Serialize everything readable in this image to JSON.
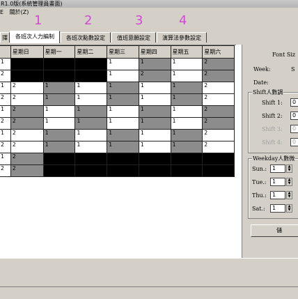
{
  "window": {
    "title": "R1.0版(系統管理員畫面)"
  },
  "menu": [
    {
      "label": "E"
    },
    {
      "label": "關於(Z)"
    }
  ],
  "annotations": [
    "1",
    "2",
    "3",
    "4"
  ],
  "tabs": [
    {
      "label": "擇"
    },
    {
      "label": "各班次人力編制"
    },
    {
      "label": "各班次點數設定"
    },
    {
      "label": "值班意願設定"
    },
    {
      "label": "演算法參數設定"
    }
  ],
  "table": {
    "headers": [
      "",
      "星期日",
      "星期一",
      "星期二",
      "星期三",
      "星期四",
      "星期五",
      "星期六"
    ],
    "rows": [
      {
        "label": "1",
        "cells": [
          {
            "c": "b",
            "v": ""
          },
          {
            "c": "b",
            "v": ""
          },
          {
            "c": "b",
            "v": ""
          },
          {
            "c": "w",
            "v": "1"
          },
          {
            "c": "g",
            "v": "1"
          },
          {
            "c": "w",
            "v": "1"
          },
          {
            "c": "g",
            "v": "2"
          }
        ]
      },
      {
        "label": "2",
        "cells": [
          {
            "c": "b",
            "v": ""
          },
          {
            "c": "b",
            "v": ""
          },
          {
            "c": "b",
            "v": ""
          },
          {
            "c": "w",
            "v": "1"
          },
          {
            "c": "g",
            "v": "2"
          },
          {
            "c": "w",
            "v": "1"
          },
          {
            "c": "g",
            "v": "2"
          }
        ]
      },
      {
        "label": "1",
        "cells": [
          {
            "c": "w",
            "v": "2"
          },
          {
            "c": "g",
            "v": "1"
          },
          {
            "c": "w",
            "v": "1"
          },
          {
            "c": "g",
            "v": "1"
          },
          {
            "c": "w",
            "v": "1"
          },
          {
            "c": "g",
            "v": "1"
          },
          {
            "c": "w",
            "v": "2"
          }
        ]
      },
      {
        "label": "2",
        "cells": [
          {
            "c": "w",
            "v": "2"
          },
          {
            "c": "g",
            "v": "1"
          },
          {
            "c": "w",
            "v": "1"
          },
          {
            "c": "g",
            "v": "1"
          },
          {
            "c": "w",
            "v": "1"
          },
          {
            "c": "g",
            "v": "1"
          },
          {
            "c": "w",
            "v": "2"
          }
        ]
      },
      {
        "label": "1",
        "cells": [
          {
            "c": "g",
            "v": "2"
          },
          {
            "c": "w",
            "v": "1"
          },
          {
            "c": "g",
            "v": "1"
          },
          {
            "c": "w",
            "v": "1"
          },
          {
            "c": "g",
            "v": "1"
          },
          {
            "c": "w",
            "v": "1"
          },
          {
            "c": "g",
            "v": "2"
          }
        ]
      },
      {
        "label": "2",
        "cells": [
          {
            "c": "g",
            "v": "2"
          },
          {
            "c": "w",
            "v": "1"
          },
          {
            "c": "g",
            "v": "1"
          },
          {
            "c": "w",
            "v": "1"
          },
          {
            "c": "g",
            "v": "1"
          },
          {
            "c": "w",
            "v": "1"
          },
          {
            "c": "g",
            "v": "2"
          }
        ]
      },
      {
        "label": "1",
        "cells": [
          {
            "c": "w",
            "v": "2"
          },
          {
            "c": "g",
            "v": "1"
          },
          {
            "c": "w",
            "v": "1"
          },
          {
            "c": "g",
            "v": "1"
          },
          {
            "c": "w",
            "v": "1"
          },
          {
            "c": "g",
            "v": "1"
          },
          {
            "c": "w",
            "v": "2"
          }
        ]
      },
      {
        "label": "2",
        "cells": [
          {
            "c": "w",
            "v": "2"
          },
          {
            "c": "g",
            "v": "1"
          },
          {
            "c": "w",
            "v": "1"
          },
          {
            "c": "g",
            "v": "1"
          },
          {
            "c": "w",
            "v": "1"
          },
          {
            "c": "g",
            "v": "1"
          },
          {
            "c": "w",
            "v": "2"
          }
        ]
      },
      {
        "label": "1",
        "cells": [
          {
            "c": "g",
            "v": "2"
          },
          {
            "c": "b",
            "v": ""
          },
          {
            "c": "b",
            "v": ""
          },
          {
            "c": "b",
            "v": ""
          },
          {
            "c": "b",
            "v": ""
          },
          {
            "c": "b",
            "v": ""
          },
          {
            "c": "b",
            "v": ""
          }
        ]
      },
      {
        "label": "2",
        "cells": [
          {
            "c": "g",
            "v": "2"
          },
          {
            "c": "b",
            "v": ""
          },
          {
            "c": "b",
            "v": ""
          },
          {
            "c": "b",
            "v": ""
          },
          {
            "c": "b",
            "v": ""
          },
          {
            "c": "b",
            "v": ""
          },
          {
            "c": "b",
            "v": ""
          }
        ]
      }
    ]
  },
  "right_panel": {
    "font_size_label": "Font Siz",
    "week_label": "Week:",
    "week_value": "S",
    "date_label": "Date:",
    "shift_group_title": "Shift人數調",
    "shifts": [
      {
        "label": "Shift 1:",
        "value": "0",
        "enabled": true
      },
      {
        "label": "Shift 2:",
        "value": "0",
        "enabled": true
      },
      {
        "label": "Shift 3:",
        "value": "0",
        "enabled": false
      },
      {
        "label": "Shift 4:",
        "value": "0",
        "enabled": false
      }
    ],
    "weekday_group_title": "Weekday人數微",
    "weekdays": [
      {
        "label": "Sun.:",
        "value": "1"
      },
      {
        "label": "Tue.:",
        "value": "1"
      },
      {
        "label": "Thu.:",
        "value": "1"
      },
      {
        "label": "Sat.:",
        "value": "1"
      }
    ],
    "button_label": "儲"
  }
}
